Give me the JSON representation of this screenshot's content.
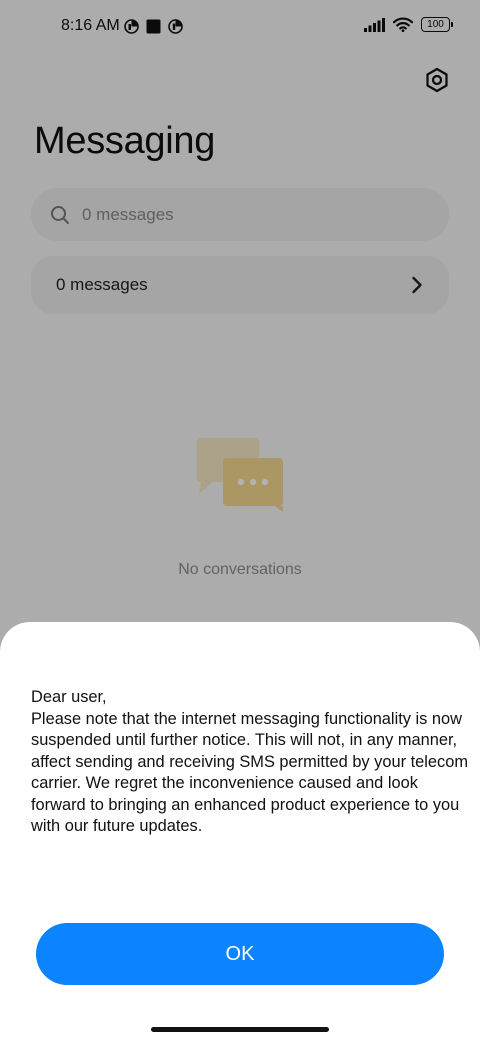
{
  "status_bar": {
    "time": "8:16 AM",
    "left_icons": [
      "notification-icon",
      "square-notification-icon",
      "app-notification-icon"
    ],
    "right_icons": [
      "signal-icon",
      "wifi-icon",
      "battery-icon"
    ],
    "battery_level": "100"
  },
  "header": {
    "title": "Messaging",
    "settings_icon": "settings-icon"
  },
  "search": {
    "placeholder": "0 messages",
    "icon": "search-icon"
  },
  "messages_row": {
    "label": "0 messages",
    "icon": "chevron-right-icon"
  },
  "empty_state": {
    "icon": "chat-bubbles-icon",
    "text": "No conversations"
  },
  "dialog": {
    "greeting": "Dear user,",
    "body": "Please note that the internet messaging functionality is now suspended until further notice. This will not, in any manner, affect sending and receiving SMS permitted by your telecom carrier. We regret the inconvenience caused and look forward to bringing an enhanced product experience to you with our future updates.",
    "ok_label": "OK"
  },
  "colors": {
    "accent": "#0d84ff",
    "background": "#f7f7f7",
    "card": "#ececec",
    "illustration": "#f5d98f"
  }
}
